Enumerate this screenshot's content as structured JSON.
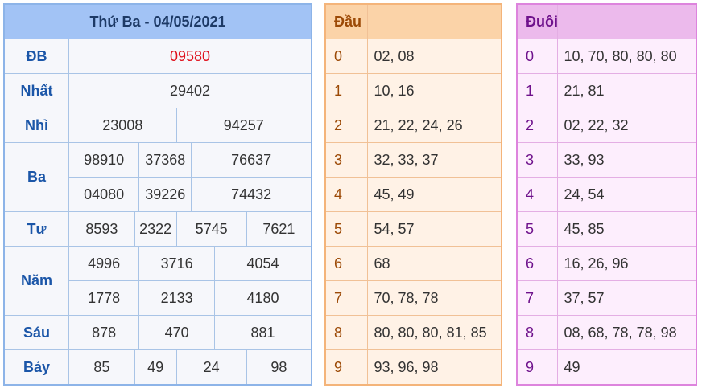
{
  "results": {
    "title": "Thứ Ba - 04/05/2021",
    "rows": [
      {
        "label": "ĐB",
        "values": [
          [
            "09580"
          ]
        ]
      },
      {
        "label": "Nhất",
        "values": [
          [
            "29402"
          ]
        ]
      },
      {
        "label": "Nhì",
        "values": [
          [
            "23008",
            "94257"
          ]
        ]
      },
      {
        "label": "Ba",
        "values": [
          [
            "98910",
            "37368",
            "76637"
          ],
          [
            "04080",
            "39226",
            "74432"
          ]
        ]
      },
      {
        "label": "Tư",
        "values": [
          [
            "8593",
            "2322",
            "5745",
            "7621"
          ]
        ]
      },
      {
        "label": "Năm",
        "values": [
          [
            "4996",
            "3716",
            "4054"
          ],
          [
            "1778",
            "2133",
            "4180"
          ]
        ]
      },
      {
        "label": "Sáu",
        "values": [
          [
            "878",
            "470",
            "881"
          ]
        ]
      },
      {
        "label": "Bảy",
        "values": [
          [
            "85",
            "49",
            "24",
            "98"
          ]
        ]
      }
    ]
  },
  "dau": {
    "header": "Đầu",
    "rows": [
      {
        "k": "0",
        "v": "02, 08"
      },
      {
        "k": "1",
        "v": "10, 16"
      },
      {
        "k": "2",
        "v": "21, 22, 24, 26"
      },
      {
        "k": "3",
        "v": "32, 33, 37"
      },
      {
        "k": "4",
        "v": "45, 49"
      },
      {
        "k": "5",
        "v": "54, 57"
      },
      {
        "k": "6",
        "v": "68"
      },
      {
        "k": "7",
        "v": "70, 78, 78"
      },
      {
        "k": "8",
        "v": "80, 80, 80, 81, 85"
      },
      {
        "k": "9",
        "v": "93, 96, 98"
      }
    ]
  },
  "duoi": {
    "header": "Đuôi",
    "rows": [
      {
        "k": "0",
        "v": "10, 70, 80, 80, 80"
      },
      {
        "k": "1",
        "v": "21, 81"
      },
      {
        "k": "2",
        "v": "02, 22, 32"
      },
      {
        "k": "3",
        "v": "33, 93"
      },
      {
        "k": "4",
        "v": "24, 54"
      },
      {
        "k": "5",
        "v": "45, 85"
      },
      {
        "k": "6",
        "v": "16, 26, 96"
      },
      {
        "k": "7",
        "v": "37, 57"
      },
      {
        "k": "8",
        "v": "08, 68, 78, 78, 98"
      },
      {
        "k": "9",
        "v": "49"
      }
    ]
  }
}
